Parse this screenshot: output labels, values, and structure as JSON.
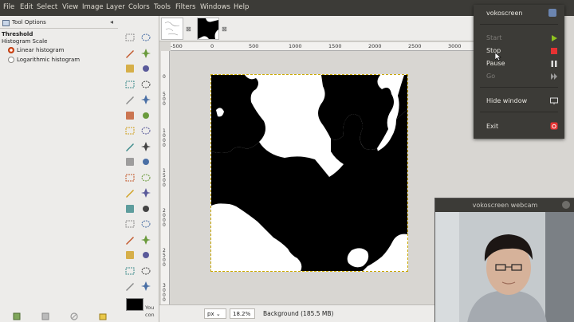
{
  "menubar": {
    "items": [
      "File",
      "Edit",
      "Select",
      "View",
      "Image",
      "Layer",
      "Colors",
      "Tools",
      "Filters",
      "Windows",
      "Help"
    ]
  },
  "dock": {
    "tab_label": "Tool Options",
    "tool_title": "Threshold",
    "scale_label": "Histogram Scale",
    "linear_label": "Linear histogram",
    "log_label": "Logarithmic histogram",
    "partial_text": "You\ncon"
  },
  "tools": [
    "rect-select",
    "ellipse-select",
    "free-select",
    "fuzzy-select",
    "select-by-color",
    "scissors-select",
    "foreground-select",
    "paths",
    "color-picker",
    "zoom",
    "measure",
    "move",
    "align",
    "crop",
    "rotate",
    "scale",
    "shear",
    "perspective",
    "flip",
    "cage",
    "text",
    "bucket-fill",
    "blend",
    "pencil",
    "paintbrush",
    "eraser",
    "airbrush",
    "ink",
    "clone",
    "heal",
    "perspective-clone",
    "blur",
    "smudge",
    "dodge-burn"
  ],
  "rulers": {
    "h_labels": [
      "-500",
      "0",
      "500",
      "1000",
      "1500",
      "2000",
      "2500",
      "3000"
    ],
    "v_labels": [
      "0",
      "500",
      "1000",
      "1500",
      "2000",
      "2500",
      "3000"
    ]
  },
  "status": {
    "unit": "px",
    "zoom": "18.2%",
    "layer": "Background (185.5 MB)"
  },
  "vokoscreen": {
    "title": "vokoscreen",
    "start": "Start",
    "stop": "Stop",
    "pause": "Pause",
    "go": "Go",
    "hide": "Hide window",
    "exit": "Exit"
  },
  "webcam": {
    "title": "vokoscreen webcam"
  },
  "colors": {
    "accent": "#dd4814",
    "menubar": "#3c3b37"
  }
}
